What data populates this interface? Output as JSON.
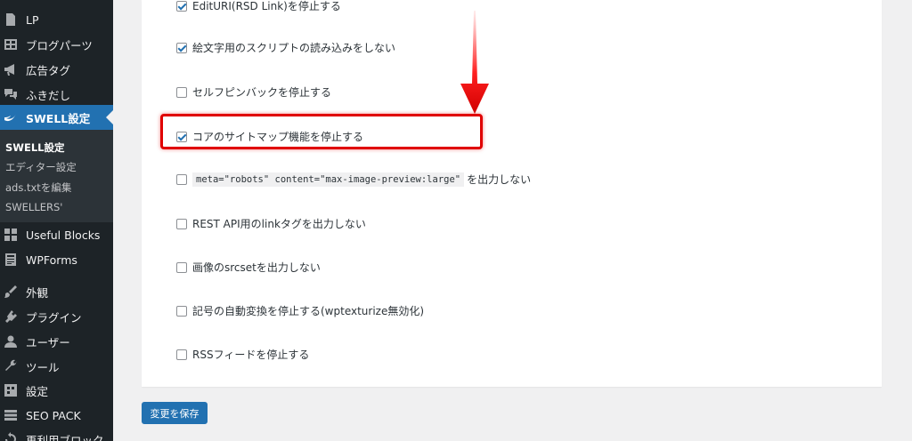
{
  "sidebar": {
    "items": [
      {
        "label": "LP",
        "icon": "page-icon"
      },
      {
        "label": "ブログパーツ",
        "icon": "grid-icon"
      },
      {
        "label": "広告タグ",
        "icon": "megaphone-icon"
      },
      {
        "label": "ふきだし",
        "icon": "speech-bubble-icon"
      },
      {
        "label": "SWELL設定",
        "icon": "swell-icon"
      },
      {
        "label": "Useful Blocks",
        "icon": "blocks-icon"
      },
      {
        "label": "WPForms",
        "icon": "form-icon"
      },
      {
        "label": "外観",
        "icon": "paintbrush-icon"
      },
      {
        "label": "プラグイン",
        "icon": "plugin-icon"
      },
      {
        "label": "ユーザー",
        "icon": "user-icon"
      },
      {
        "label": "ツール",
        "icon": "wrench-icon"
      },
      {
        "label": "設定",
        "icon": "settings-icon"
      },
      {
        "label": "SEO PACK",
        "icon": "list-icon"
      },
      {
        "label": "再利用ブロック",
        "icon": "reusable-icon"
      }
    ],
    "submenu": [
      {
        "label": "SWELL設定"
      },
      {
        "label": "エディター設定"
      },
      {
        "label": "ads.txtを編集"
      },
      {
        "label": "SWELLERS'"
      }
    ]
  },
  "options": [
    {
      "label": "EditURI(RSD Link)を停止する",
      "checked": true
    },
    {
      "label": "絵文字用のスクリプトの読み込みをしない",
      "checked": true
    },
    {
      "label": "セルフピンバックを停止する",
      "checked": false
    },
    {
      "label": "コアのサイトマップ機能を停止する",
      "checked": true
    },
    {
      "code": "meta=\"robots\" content=\"max-image-preview:large\"",
      "label": "を出力しない",
      "checked": false
    },
    {
      "label": "REST API用のlinkタグを出力しない",
      "checked": false
    },
    {
      "label": "画像のsrcsetを出力しない",
      "checked": false
    },
    {
      "label": "記号の自動変換を停止する(wptexturize無効化)",
      "checked": false
    },
    {
      "label": "RSSフィードを停止する",
      "checked": false
    }
  ],
  "save_button": {
    "label": "変更を保存"
  },
  "colors": {
    "sidebar_bg": "#1d2327",
    "accent": "#2271b1",
    "highlight": "#e00000"
  }
}
